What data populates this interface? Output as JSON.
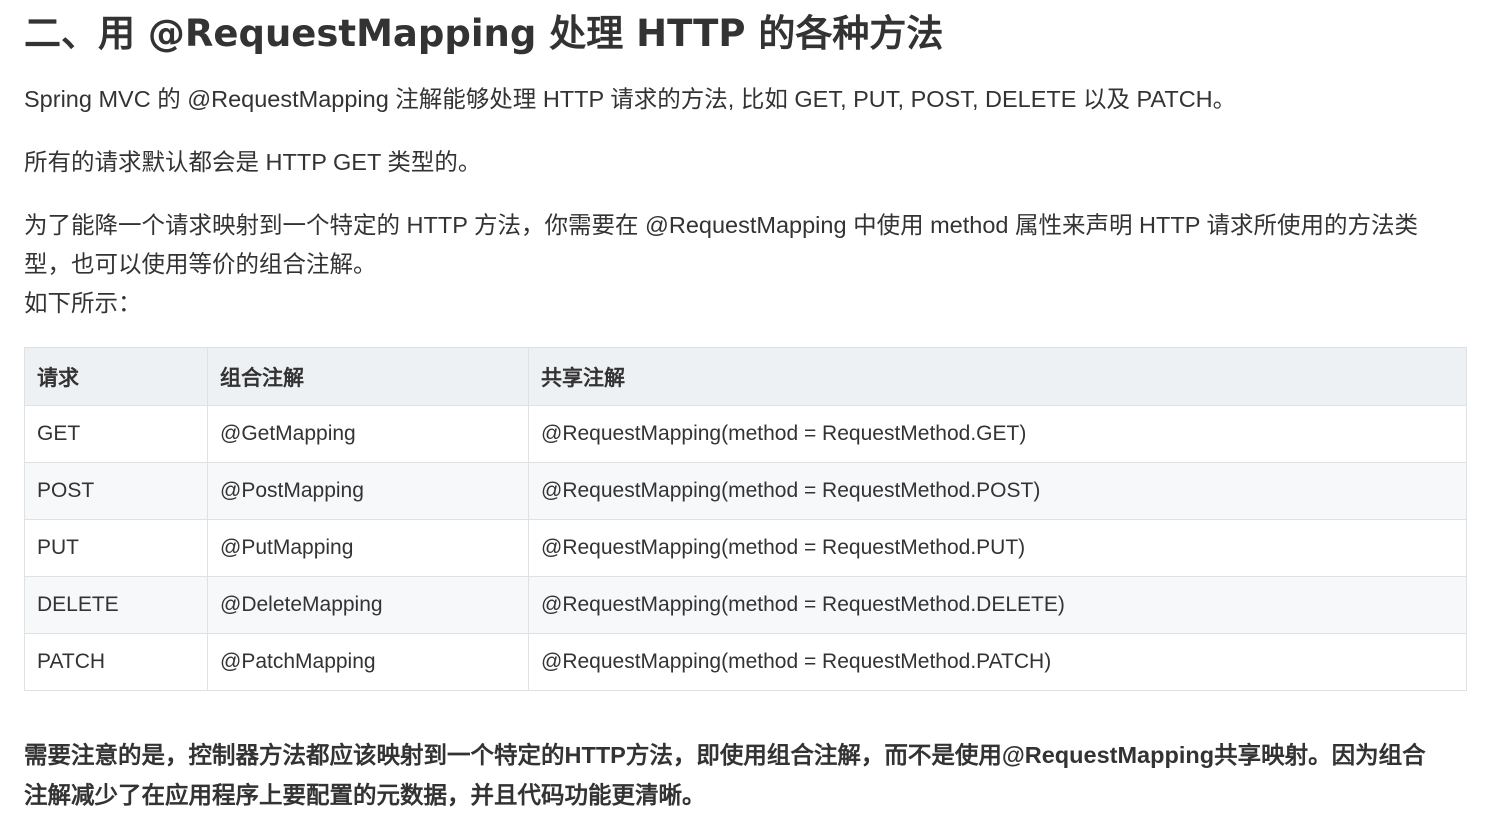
{
  "heading": "二、用 @RequestMapping 处理 HTTP 的各种方法",
  "paragraphs": {
    "intro": "Spring MVC 的 @RequestMapping 注解能够处理 HTTP 请求的方法, 比如 GET, PUT, POST, DELETE 以及 PATCH。",
    "default": "所有的请求默认都会是 HTTP GET 类型的。",
    "method_line1": "为了能降一个请求映射到一个特定的 HTTP 方法，你需要在 @RequestMapping 中使用 method 属性来声明 HTTP 请求所使用的方法类",
    "method_line2": "型，也可以使用等价的组合注解。",
    "method_line3": "如下所示："
  },
  "table": {
    "headers": [
      "请求",
      "组合注解",
      "共享注解"
    ],
    "rows": [
      [
        "GET",
        "@GetMapping",
        "@RequestMapping(method = RequestMethod.GET)"
      ],
      [
        "POST",
        "@PostMapping",
        "@RequestMapping(method = RequestMethod.POST)"
      ],
      [
        "PUT",
        "@PutMapping",
        "@RequestMapping(method = RequestMethod.PUT)"
      ],
      [
        "DELETE",
        "@DeleteMapping",
        "@RequestMapping(method = RequestMethod.DELETE)"
      ],
      [
        "PATCH",
        "@PatchMapping",
        "@RequestMapping(method = RequestMethod.PATCH)"
      ]
    ]
  },
  "note": {
    "line1": "需要注意的是，控制器方法都应该映射到一个特定的HTTP方法，即使用组合注解，而不是使用@RequestMapping共享映射。因为组合",
    "line2": "注解减少了在应用程序上要配置的元数据，并且代码功能更清晰。"
  },
  "colors": {
    "text": "#333333",
    "table_header_bg": "#eef1f4",
    "table_stripe_bg": "#f6f8fa",
    "table_border": "#dfe2e5"
  }
}
